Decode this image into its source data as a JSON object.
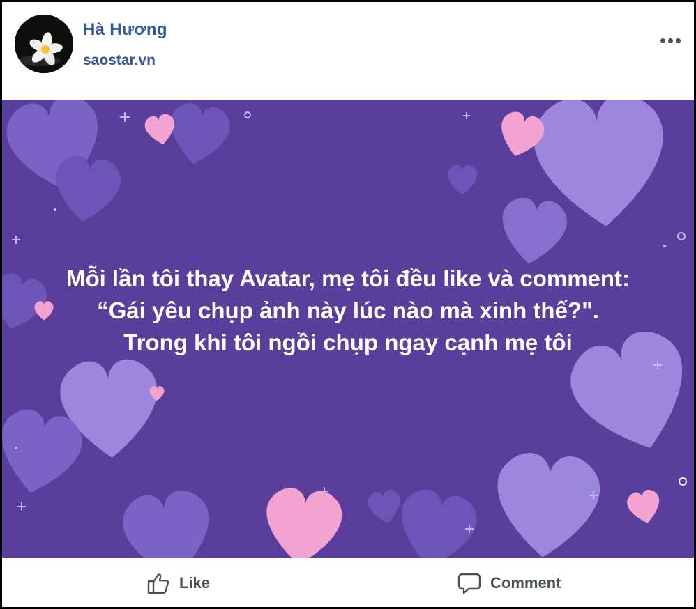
{
  "post": {
    "author_name": "Hà Hương",
    "source": "saostar.vn",
    "more_icon": "more-options-icon",
    "avatar_icon": "plumeria-flower-avatar"
  },
  "image": {
    "background_color": "#5a3e9c",
    "heart_colors": [
      "#7a62c6",
      "#9d87dd",
      "#f3a3cf"
    ],
    "caption_lines": [
      "Mỗi lần tôi thay Avatar, mẹ tôi đều like và comment:",
      "“Gái yêu chụp ảnh này lúc nào mà xinh thế?\".",
      "Trong khi tôi ngồi chụp ngay cạnh mẹ tôi"
    ]
  },
  "actions": {
    "like_label": "Like",
    "comment_label": "Comment",
    "like_icon": "thumbs-up-icon",
    "comment_icon": "comment-bubble-icon"
  },
  "colors": {
    "author_link": "#365899",
    "action_text": "#4b4f56"
  }
}
